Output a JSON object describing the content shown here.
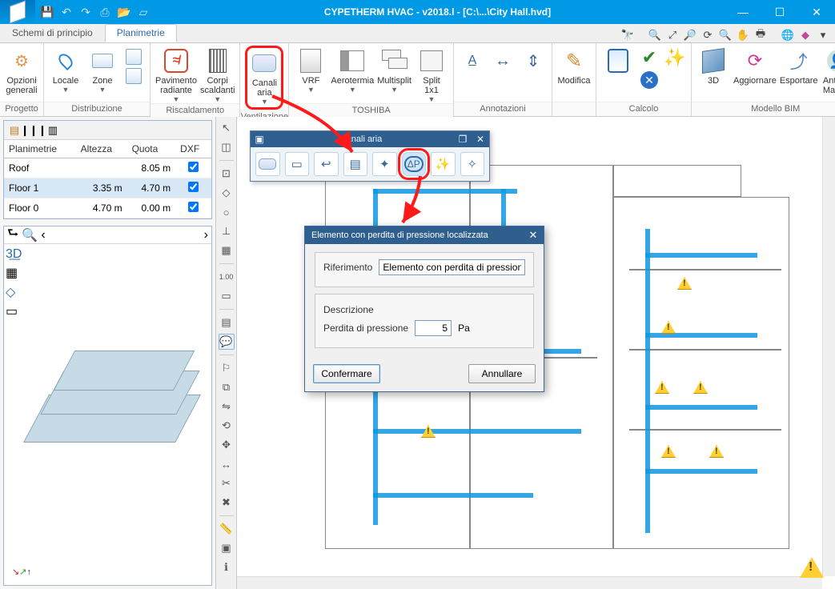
{
  "title": "CYPETHERM HVAC - v2018.l - [C:\\...\\City Hall.hvd]",
  "tabs": {
    "t0": "Schemi di principio",
    "t1": "Planimetrie"
  },
  "ribbon": {
    "progetto": {
      "cap": "Progetto",
      "opzioni": "Opzioni\ngenerali"
    },
    "distribuzione": {
      "cap": "Distribuzione",
      "locale": "Locale",
      "zone": "Zone"
    },
    "riscaldamento": {
      "cap": "Riscaldamento",
      "pav": "Pavimento\nradiante",
      "corpi": "Corpi\nscaldanti"
    },
    "ventilazione": {
      "cap": "Ventilazione",
      "canali": "Canali\naria"
    },
    "toshiba": {
      "cap": "TOSHIBA",
      "vrf": "VRF",
      "aero": "Aerotermia",
      "multi": "Multisplit",
      "split": "Split\n1x1"
    },
    "annotazioni": {
      "cap": "Annotazioni"
    },
    "modifica": {
      "cap": "",
      "lbl": "Modifica"
    },
    "calcolo": {
      "cap": "Calcolo"
    },
    "bim": {
      "cap": "Modello BIM",
      "c3d": "3D",
      "agg": "Aggiornare",
      "esp": "Esportare",
      "user": "Antonio\nMarotta"
    }
  },
  "plansTable": {
    "headers": {
      "h0": "Planimetrie",
      "h1": "Altezza",
      "h2": "Quota",
      "h3": "DXF"
    },
    "rows": [
      {
        "name": "Roof",
        "alt": "",
        "quota": "8.05 m",
        "dxf": true
      },
      {
        "name": "Floor 1",
        "alt": "3.35 m",
        "quota": "4.70 m",
        "dxf": true,
        "selected": true
      },
      {
        "name": "Floor 0",
        "alt": "4.70 m",
        "quota": "0.00 m",
        "dxf": true
      }
    ]
  },
  "floatbar": {
    "title": "Canali aria"
  },
  "dialog": {
    "title": "Elemento con perdita di pressione localizzata",
    "rif_label": "Riferimento",
    "rif_value": "Elemento con perdita di pressione",
    "desc_label": "Descrizione",
    "perdita_label": "Perdita di pressione",
    "perdita_value": "5",
    "perdita_unit": "Pa",
    "ok": "Confermare",
    "cancel": "Annullare"
  }
}
